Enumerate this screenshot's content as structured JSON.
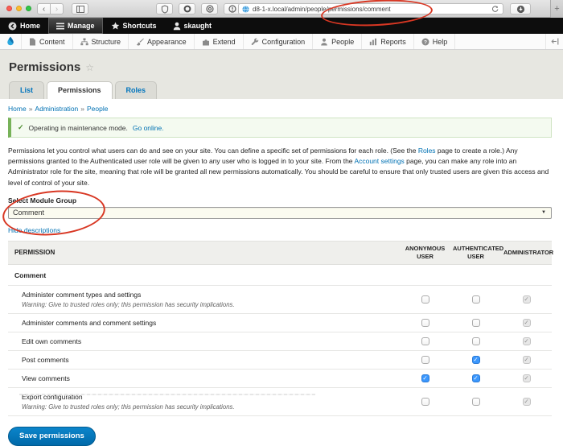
{
  "icons": {
    "check": "✓",
    "star_outline": "☆",
    "dropdown_arrow": "▼",
    "breadcrumb_separator": "»",
    "plus": "+",
    "back_chevron": "‹",
    "forward_chevron": "›"
  },
  "colors": {
    "accent_blue": "#0074bd",
    "link_blue": "#0071b3",
    "status_green": "#77b259",
    "checked_blue": "#3b97fd",
    "annotation_red": "#d83723",
    "toolbar_black": "#0d0d0d"
  },
  "browser": {
    "url": "d8-1-x.local/admin/people/permissions/comment"
  },
  "admin_toolbar": {
    "items": [
      {
        "label": "Home"
      },
      {
        "label": "Manage",
        "active": true
      },
      {
        "label": "Shortcuts"
      },
      {
        "label": "skaught"
      }
    ]
  },
  "admin_menu": {
    "items": [
      {
        "label": "Content"
      },
      {
        "label": "Structure"
      },
      {
        "label": "Appearance"
      },
      {
        "label": "Extend"
      },
      {
        "label": "Configuration"
      },
      {
        "label": "People"
      },
      {
        "label": "Reports"
      },
      {
        "label": "Help"
      }
    ]
  },
  "page": {
    "title": "Permissions",
    "tabs": [
      {
        "label": "List",
        "active": false
      },
      {
        "label": "Permissions",
        "active": true
      },
      {
        "label": "Roles",
        "active": false
      }
    ],
    "breadcrumb": [
      "Home",
      "Administration",
      "People"
    ],
    "status": {
      "text": "Operating in maintenance mode.",
      "link": "Go online."
    },
    "description": {
      "part1": "Permissions let you control what users can do and see on your site. You can define a specific set of permissions for each role. (See the ",
      "link1": "Roles",
      "part2": " page to create a role.) Any permissions granted to the Authenticated user role will be given to any user who is logged in to your site. From the ",
      "link2": "Account settings",
      "part3": " page, you can make any role into an Administrator role for the site, meaning that role will be granted all new permissions automatically. You should be careful to ensure that only trusted users are given this access and level of control of your site."
    },
    "module_group": {
      "label": "Select Module Group",
      "selected": "Comment"
    },
    "hide_descriptions": "Hide descriptions"
  },
  "table": {
    "headers": {
      "permission": "PERMISSION",
      "anonymous": "ANONYMOUS USER",
      "authenticated": "AUTHENTICATED USER",
      "administrator": "ADMINISTRATOR"
    },
    "group": "Comment",
    "warning_text": "Warning: Give to trusted roles only; this permission has security implications.",
    "rows": [
      {
        "label": "Administer comment types and settings",
        "warning": true,
        "anonymous": "off",
        "authenticated": "off",
        "administrator": "disabled"
      },
      {
        "label": "Administer comments and comment settings",
        "warning": false,
        "anonymous": "off",
        "authenticated": "off",
        "administrator": "disabled"
      },
      {
        "label": "Edit own comments",
        "warning": false,
        "anonymous": "off",
        "authenticated": "off",
        "administrator": "disabled"
      },
      {
        "label": "Post comments",
        "warning": false,
        "anonymous": "off",
        "authenticated": "on",
        "administrator": "disabled"
      },
      {
        "label": "View comments",
        "warning": false,
        "anonymous": "on",
        "authenticated": "on",
        "administrator": "disabled"
      },
      {
        "label": "Export configuration",
        "warning": true,
        "anonymous": "off",
        "authenticated": "off",
        "administrator": "disabled"
      }
    ]
  },
  "save_button": "Save permissions"
}
